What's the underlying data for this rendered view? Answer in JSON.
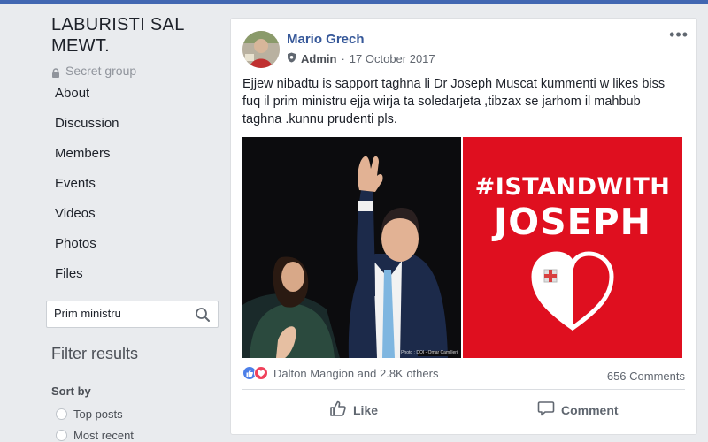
{
  "group": {
    "name": "LABURISTI SAL MEWT.",
    "privacy": "Secret group"
  },
  "nav": {
    "items": [
      "About",
      "Discussion",
      "Members",
      "Events",
      "Videos",
      "Photos",
      "Files"
    ]
  },
  "search": {
    "value": "Prim ministru"
  },
  "filter": {
    "title": "Filter results",
    "sort_by": "Sort by",
    "options": [
      "Top posts",
      "Most recent"
    ]
  },
  "post": {
    "author": "Mario Grech",
    "role": "Admin",
    "separator": "·",
    "date": "17 October 2017",
    "more": "•••",
    "text": "Ejjew nibadtu is sapport taghna li Dr Joseph Muscat kummenti w likes biss fuq il prim ministru ejja wirja ta soledarjeta ,tibzax se jarhom il mahbub taghna .kunnu prudenti pls.",
    "image_right": {
      "line1": "#ISTANDWITH",
      "line2": "JOSEPH",
      "background": "#df0f1f"
    },
    "photo_credit": "Photo : DOI - Omar Camilleri",
    "reactions_text": "Dalton Mangion and 2.8K others",
    "comments_count": "656 Comments",
    "like_label": "Like",
    "comment_label": "Comment"
  },
  "colors": {
    "fb_blue": "#4267b2",
    "link_blue": "#365899",
    "page_bg": "#e9ebee"
  }
}
